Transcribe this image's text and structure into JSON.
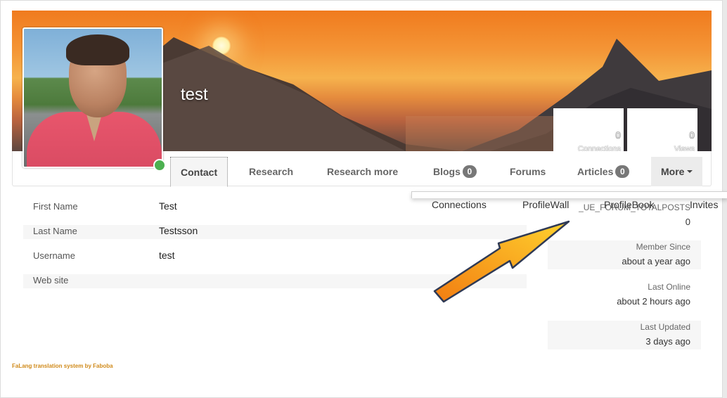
{
  "profile": {
    "name": "test",
    "status": "online"
  },
  "cover_stats": [
    {
      "value": "0",
      "label": "Connections"
    },
    {
      "value": "0",
      "label": "Views"
    }
  ],
  "tabs": [
    {
      "label": "Contact",
      "active": true
    },
    {
      "label": "Research"
    },
    {
      "label": "Research more"
    },
    {
      "label": "Blogs",
      "badge": "0"
    },
    {
      "label": "Forums"
    },
    {
      "label": "Articles",
      "badge": "0"
    },
    {
      "label": "More"
    }
  ],
  "more_menu": [
    "Connections",
    "ProfileWall",
    "ProfileBook",
    "Invites"
  ],
  "contact": [
    {
      "label": "First Name",
      "value": "Test"
    },
    {
      "label": "Last Name",
      "value": "Testsson"
    },
    {
      "label": "Username",
      "value": "test"
    },
    {
      "label": "Web site",
      "value": ""
    }
  ],
  "side_stats": [
    {
      "label": "_UE_FORUM_TOTALPOSTS",
      "value": "0"
    },
    {
      "label": "Member Since",
      "value": "about a year ago"
    },
    {
      "label": "Last Online",
      "value": "about 2 hours ago"
    },
    {
      "label": "Last Updated",
      "value": "3 days ago"
    }
  ],
  "footer": {
    "text": "FaLang translation system by Faboba"
  },
  "colors": {
    "online": "#4cb050",
    "arrow": "#f7a21b",
    "footer": "#d08a1a"
  }
}
